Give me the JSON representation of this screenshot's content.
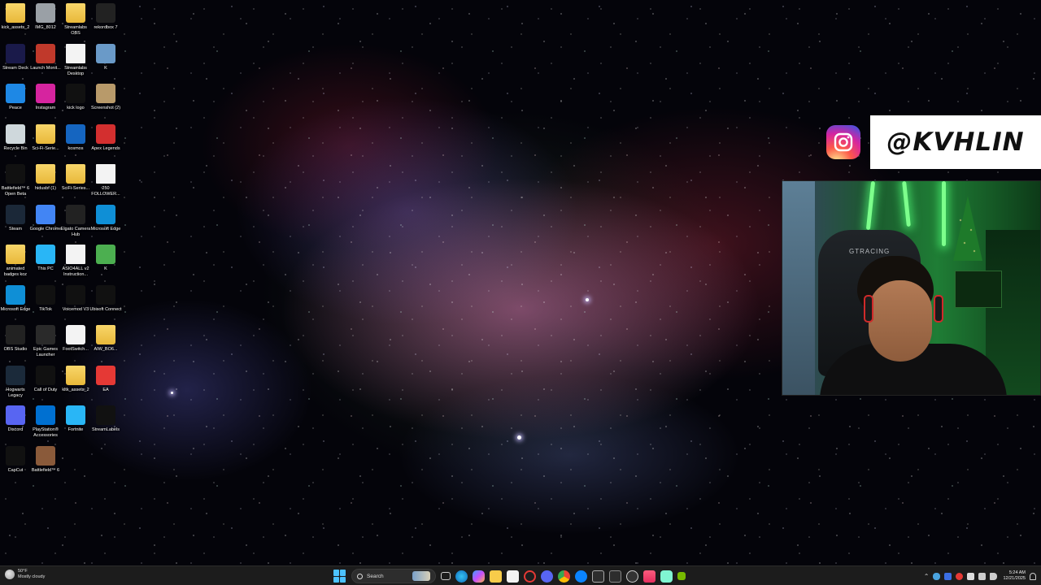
{
  "desktop": {
    "icons": [
      {
        "label": "kick_assets_2",
        "icon": "folder-icon",
        "color": "#e8b83a"
      },
      {
        "label": "IMG_8012",
        "icon": "image-icon",
        "color": "#9aa0a6"
      },
      {
        "label": "Streamlabs OBS",
        "icon": "folder-icon",
        "color": "#e8b83a"
      },
      {
        "label": "rekordbox 7",
        "icon": "rekordbox-icon",
        "color": "#222222"
      },
      {
        "label": "Stream Deck",
        "icon": "stream-deck-icon",
        "color": "#1a1a4a"
      },
      {
        "label": "Launch Monit...",
        "icon": "monitor-icon",
        "color": "#c0392b"
      },
      {
        "label": "Streamlabs Desktop",
        "icon": "document-icon",
        "color": "#f3f3f3"
      },
      {
        "label": "K",
        "icon": "photo-icon",
        "color": "#6a9ac8"
      },
      {
        "label": "Peace",
        "icon": "peace-icon",
        "color": "#1e88e5"
      },
      {
        "label": "Instagram",
        "icon": "instagram-icon",
        "color": "#d6249f"
      },
      {
        "label": "kick logo",
        "icon": "kick-icon",
        "color": "#111111"
      },
      {
        "label": "Screenshot (2)",
        "icon": "screenshot-icon",
        "color": "#b89a6a"
      },
      {
        "label": "Recycle Bin",
        "icon": "recycle-bin-icon",
        "color": "#cfd8dc"
      },
      {
        "label": "Sci-Fi-Serie...",
        "icon": "folder-icon",
        "color": "#e8b83a"
      },
      {
        "label": "kosmos",
        "icon": "kosmos-icon",
        "color": "#1565c0"
      },
      {
        "label": "Apex Legends",
        "icon": "apex-icon",
        "color": "#d32f2f"
      },
      {
        "label": "Battlefield™ 6 Open Beta",
        "icon": "battlefield-icon",
        "color": "#111111"
      },
      {
        "label": "hidusbf (1)",
        "icon": "folder-icon",
        "color": "#e8b83a"
      },
      {
        "label": "SciFi-Series...",
        "icon": "folder-icon",
        "color": "#e8b83a"
      },
      {
        "label": "250 FOLLOWER...",
        "icon": "document-icon",
        "color": "#f3f3f3"
      },
      {
        "label": "Steam",
        "icon": "steam-icon",
        "color": "#1b2838"
      },
      {
        "label": "Google Chrome",
        "icon": "chrome-icon",
        "color": "#4285f4"
      },
      {
        "label": "Elgato Camera Hub",
        "icon": "elgato-icon",
        "color": "#222222"
      },
      {
        "label": "Microsoft Edge",
        "icon": "edge-icon",
        "color": "#0f8fd6"
      },
      {
        "label": "animated badges koz",
        "icon": "folder-icon",
        "color": "#e8b83a"
      },
      {
        "label": "This PC",
        "icon": "this-pc-icon",
        "color": "#29b6f6"
      },
      {
        "label": "ASIO4ALL v2 Instruction...",
        "icon": "document-icon",
        "color": "#f3f3f3"
      },
      {
        "label": "K",
        "icon": "photo-icon",
        "color": "#4caf50"
      },
      {
        "label": "Microsoft Edge",
        "icon": "edge-icon",
        "color": "#0f8fd6"
      },
      {
        "label": "TikTok",
        "icon": "tiktok-icon",
        "color": "#111111"
      },
      {
        "label": "Voicemod V3",
        "icon": "voicemod-icon",
        "color": "#111111"
      },
      {
        "label": "Ubisoft Connect",
        "icon": "ubisoft-icon",
        "color": "#111111"
      },
      {
        "label": "OBS Studio",
        "icon": "obs-icon",
        "color": "#222222"
      },
      {
        "label": "Epic Games Launcher",
        "icon": "epic-icon",
        "color": "#2a2a2a"
      },
      {
        "label": "FootSwitch...",
        "icon": "footswitch-icon",
        "color": "#f3f3f3"
      },
      {
        "label": "AIW_BO6...",
        "icon": "folder-icon",
        "color": "#e8b83a"
      },
      {
        "label": "Hogwarts Legacy",
        "icon": "hogwarts-icon",
        "color": "#1b2a3a"
      },
      {
        "label": "Call of Duty",
        "icon": "cod-icon",
        "color": "#111111"
      },
      {
        "label": "kltk_assets_2",
        "icon": "folder-icon",
        "color": "#e8b83a"
      },
      {
        "label": "EA",
        "icon": "ea-icon",
        "color": "#e53935"
      },
      {
        "label": "Discord",
        "icon": "discord-icon",
        "color": "#5865f2"
      },
      {
        "label": "PlayStation® Accessories",
        "icon": "playstation-icon",
        "color": "#0070d1"
      },
      {
        "label": "Fortnite",
        "icon": "fortnite-icon",
        "color": "#29b6f6"
      },
      {
        "label": "StreamLabels",
        "icon": "streamlabels-icon",
        "color": "#111111"
      },
      {
        "label": "CapCut",
        "icon": "capcut-icon",
        "color": "#111111"
      },
      {
        "label": "Battlefield™ 6",
        "icon": "battlefield-icon",
        "color": "#8a5a3a"
      }
    ]
  },
  "overlay": {
    "instagram_handle": "@KVHLIN",
    "instagram_icon": "instagram-icon",
    "webcam_chair_text": "GTRACING"
  },
  "taskbar": {
    "weather_temp": "50°F",
    "weather_desc": "Mostly cloudy",
    "search_placeholder": "Search",
    "time": "5:24 AM",
    "date": "12/21/2025",
    "accent_color": "#4cc2ff"
  }
}
